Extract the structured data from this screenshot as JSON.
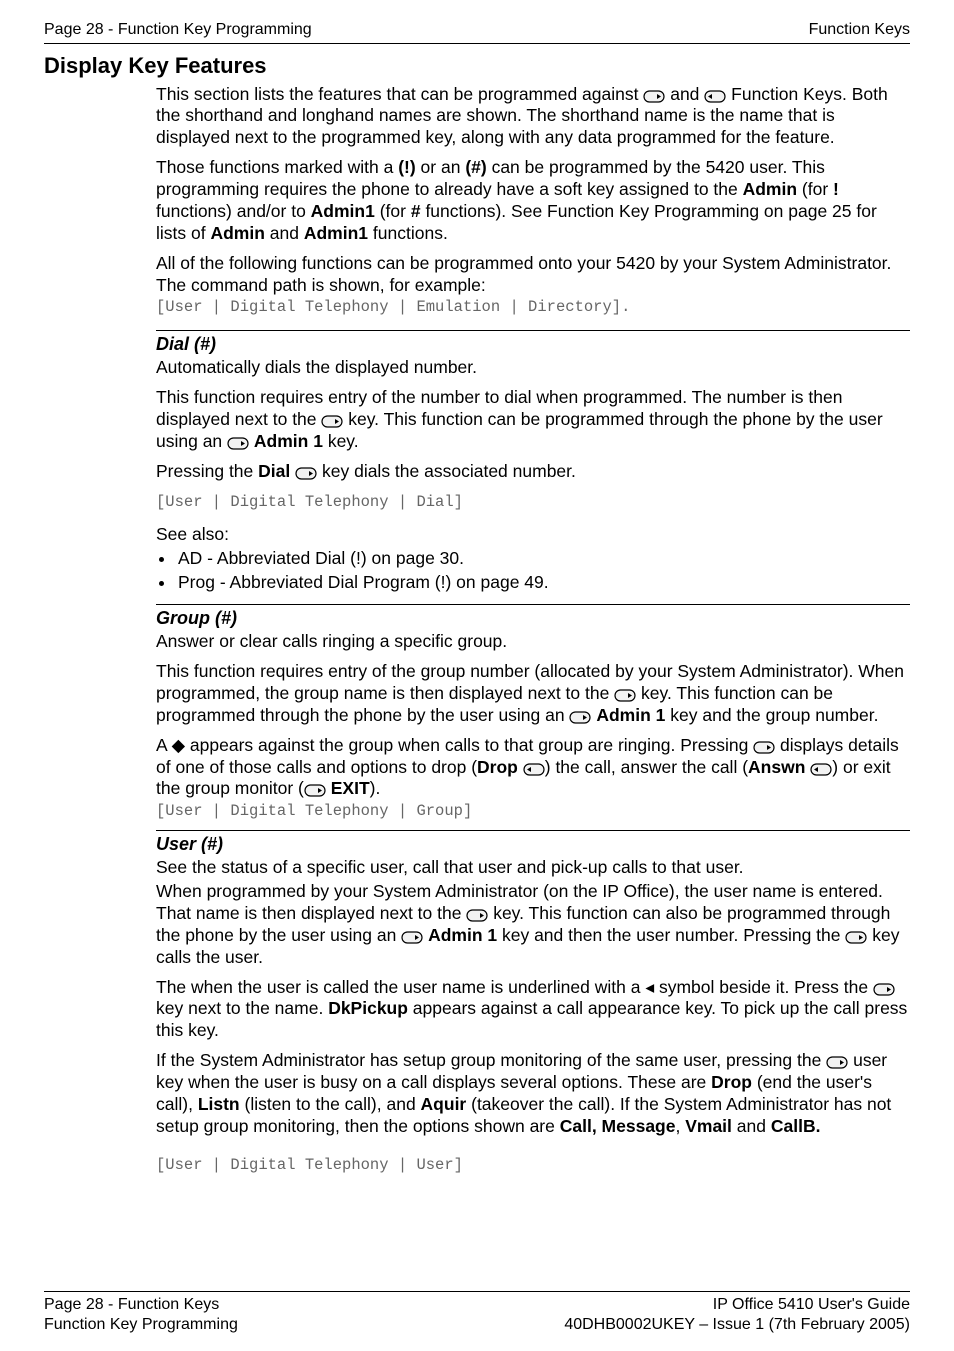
{
  "header": {
    "left": "Page 28 - Function Key Programming",
    "right": "Function Keys"
  },
  "title": "Display Key Features",
  "intro": {
    "p1a": "This section lists the features that can be programmed against ",
    "p1b": " and ",
    "p1c": " Function Keys. Both the shorthand and longhand names are shown. The shorthand name is the name that is displayed next to the programmed key, along with any data programmed for the feature.",
    "p2a": "Those functions marked with a ",
    "p2b": "(!)",
    "p2c": " or an ",
    "p2d": "(#)",
    "p2e": " can be programmed by the 5420 user. This programming requires the phone to already have a soft key assigned to the ",
    "p2f": "Admin",
    "p2g": " (for ",
    "p2h": "!",
    "p2i": " functions) and/or to ",
    "p2j": "Admin1",
    "p2k": " (for ",
    "p2l": "#",
    "p2m": " functions). See Function Key Programming on page 25 for lists of ",
    "p2n": "Admin",
    "p2o": " and ",
    "p2p": "Admin1",
    "p2q": " functions.",
    "p3": "All of the following functions can be programmed onto your 5420 by your System Administrator. The command path is shown, for example:",
    "cmd": "[User | Digital Telephony | Emulation | Directory]."
  },
  "dial": {
    "heading": "Dial (#)",
    "p1": "Automatically dials the displayed number.",
    "p2a": "This function requires entry of the number to dial when programmed. The number is then displayed next to the ",
    "p2b": " key. This function can be programmed through the phone by the user using an ",
    "p2c": " ",
    "p2d": "Admin 1",
    "p2e": " key.",
    "p3a": "Pressing the ",
    "p3b": "Dial",
    "p3c": " ",
    "p3d": " key dials the associated number.",
    "cmd": "[User | Digital Telephony | Dial]",
    "see": "See also:",
    "b1": "AD - Abbreviated Dial (!) on page 30.",
    "b2": "Prog - Abbreviated Dial Program (!) on page 49."
  },
  "group": {
    "heading": "Group (#)",
    "p1": "Answer or clear calls ringing a specific group.",
    "p2a": "This function requires entry of the group number (allocated by your System Administrator). When programmed, the group name is then displayed next to the ",
    "p2b": " key. This function can be programmed through the phone by the user using an ",
    "p2c": " ",
    "p2d": "Admin 1",
    "p2e": " key and the group number.",
    "p3a": "A ",
    "p3b": " appears against the group when calls to that group are ringing. Pressing ",
    "p3c": " displays details of one of those calls and options to drop (",
    "p3d": "Drop",
    "p3e": " ",
    "p3f": ") the call, answer the call (",
    "p3g": "Answn",
    "p3h": " ",
    "p3i": ") or exit the group monitor (",
    "p3j": " ",
    "p3k": "EXIT",
    "p3l": ").",
    "cmd": "[User | Digital Telephony | Group]"
  },
  "user": {
    "heading": "User (#)",
    "p1": "See the status of a specific user, call that user and pick-up calls to that user.",
    "p2a": "When programmed by your System Administrator (on the IP Office), the user name is entered. That name is then displayed next to the ",
    "p2b": " key. This function can also be programmed through the phone by the user using an ",
    "p2c": " ",
    "p2d": "Admin 1",
    "p2e": " key and then the user number. Pressing the ",
    "p2f": " key calls the user.",
    "p3a": "The when the user is called the user name is underlined with a ",
    "p3b": " symbol beside it. Press the ",
    "p3c": " key next to the name. ",
    "p3d": "DkPickup",
    "p3e": " appears against a call appearance key. To pick up the call press this key.",
    "p4a": "If the System Administrator has setup group monitoring of the same user, pressing the ",
    "p4b": " user key when the user is busy on a call displays several options. These are ",
    "p4c": "Drop",
    "p4d": " (end the user's call), ",
    "p4e": "Listn",
    "p4f": " (listen to the call), and ",
    "p4g": "Aquir",
    "p4h": " (takeover the call). If the System Administrator has not setup group monitoring, then the options shown are ",
    "p4i": "Call, Message",
    "p4j": ", ",
    "p4k": "Vmail",
    "p4l": " and ",
    "p4m": "CallB.",
    "cmd": "[User | Digital Telephony | User]"
  },
  "footer": {
    "left1": "Page 28 - Function Keys",
    "left2": "Function Key Programming",
    "right1": "IP Office 5410 User's Guide",
    "right2": "40DHB0002UKEY – Issue 1 (7th February 2005)"
  },
  "glyphs": {
    "diamond": "◆",
    "triLeft": "◂"
  }
}
